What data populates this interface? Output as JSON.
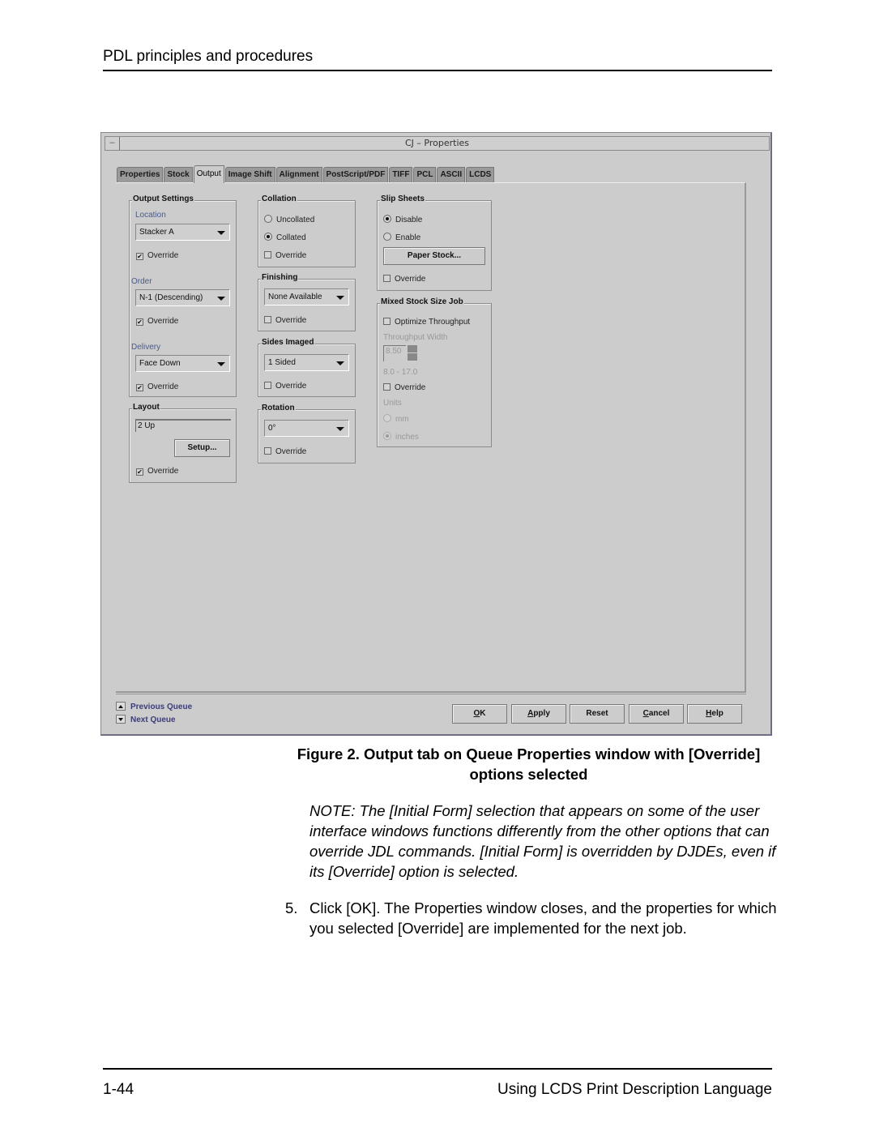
{
  "page": {
    "header": "PDL principles and procedures",
    "footer_page": "1-44",
    "footer_title": "Using LCDS Print Description Language"
  },
  "window": {
    "title": "CJ – Properties",
    "system_menu_glyph": "–",
    "tabs": [
      {
        "label": "Properties",
        "active": false
      },
      {
        "label": "Stock",
        "active": false
      },
      {
        "label": "Output",
        "active": true
      },
      {
        "label": "Image Shift",
        "active": false
      },
      {
        "label": "Alignment",
        "active": false
      },
      {
        "label": "PostScript/PDF",
        "active": false
      },
      {
        "label": "TIFF",
        "active": false
      },
      {
        "label": "PCL",
        "active": false
      },
      {
        "label": "ASCII",
        "active": false
      },
      {
        "label": "LCDS",
        "active": false
      }
    ],
    "output_settings": {
      "legend": "Output Settings",
      "location_label": "Location",
      "location_value": "Stacker A",
      "location_override": "Override",
      "location_override_checked": true,
      "order_label": "Order",
      "order_value": "N-1 (Descending)",
      "order_override": "Override",
      "order_override_checked": true,
      "delivery_label": "Delivery",
      "delivery_value": "Face Down",
      "delivery_override": "Override",
      "delivery_override_checked": true
    },
    "layout": {
      "legend": "Layout",
      "value": "2 Up",
      "setup_button": "Setup...",
      "override": "Override",
      "override_checked": true
    },
    "collation": {
      "legend": "Collation",
      "options": [
        {
          "label": "Uncollated",
          "selected": false
        },
        {
          "label": "Collated",
          "selected": true
        }
      ],
      "override": "Override",
      "override_checked": false
    },
    "finishing": {
      "legend": "Finishing",
      "value": "None Available",
      "override": "Override",
      "override_checked": false
    },
    "sides_imaged": {
      "legend": "Sides Imaged",
      "value": "1 Sided",
      "override": "Override",
      "override_checked": false
    },
    "rotation": {
      "legend": "Rotation",
      "value": "0°",
      "override": "Override",
      "override_checked": false
    },
    "slip_sheets": {
      "legend": "Slip Sheets",
      "options": [
        {
          "label": "Disable",
          "selected": true
        },
        {
          "label": "Enable",
          "selected": false
        }
      ],
      "paper_stock_button": "Paper Stock...",
      "override": "Override",
      "override_checked": false
    },
    "mixed_stock": {
      "legend": "Mixed Stock Size Job",
      "optimize": "Optimize Throughput",
      "optimize_checked": false,
      "width_label": "Throughput Width",
      "width_value": "8.50",
      "range": "8.0 - 17.0",
      "override": "Override",
      "override_checked": false,
      "units_label": "Units",
      "units": [
        {
          "label": "mm",
          "selected": false
        },
        {
          "label": "inches",
          "selected": true
        }
      ]
    },
    "nav": {
      "previous": "Previous Queue",
      "next": "Next Queue"
    },
    "buttons": {
      "ok": {
        "mnemonic": "O",
        "rest": "K"
      },
      "apply": {
        "mnemonic": "A",
        "rest": "pply"
      },
      "reset": "Reset",
      "cancel": {
        "mnemonic": "C",
        "rest": "ancel"
      },
      "help": {
        "mnemonic": "H",
        "rest": "elp"
      }
    }
  },
  "caption": "Figure 2. Output tab on Queue Properties window with [Override] options selected",
  "note": "NOTE:  The [Initial Form] selection that appears on some of the user interface windows functions differently from the other options that can override JDL commands. [Initial Form] is overridden by DJDEs, even if its [Override] option is selected.",
  "step": {
    "number": "5.",
    "text": "Click [OK]. The Properties window closes, and the properties for which you selected [Override] are implemented for the next job."
  }
}
